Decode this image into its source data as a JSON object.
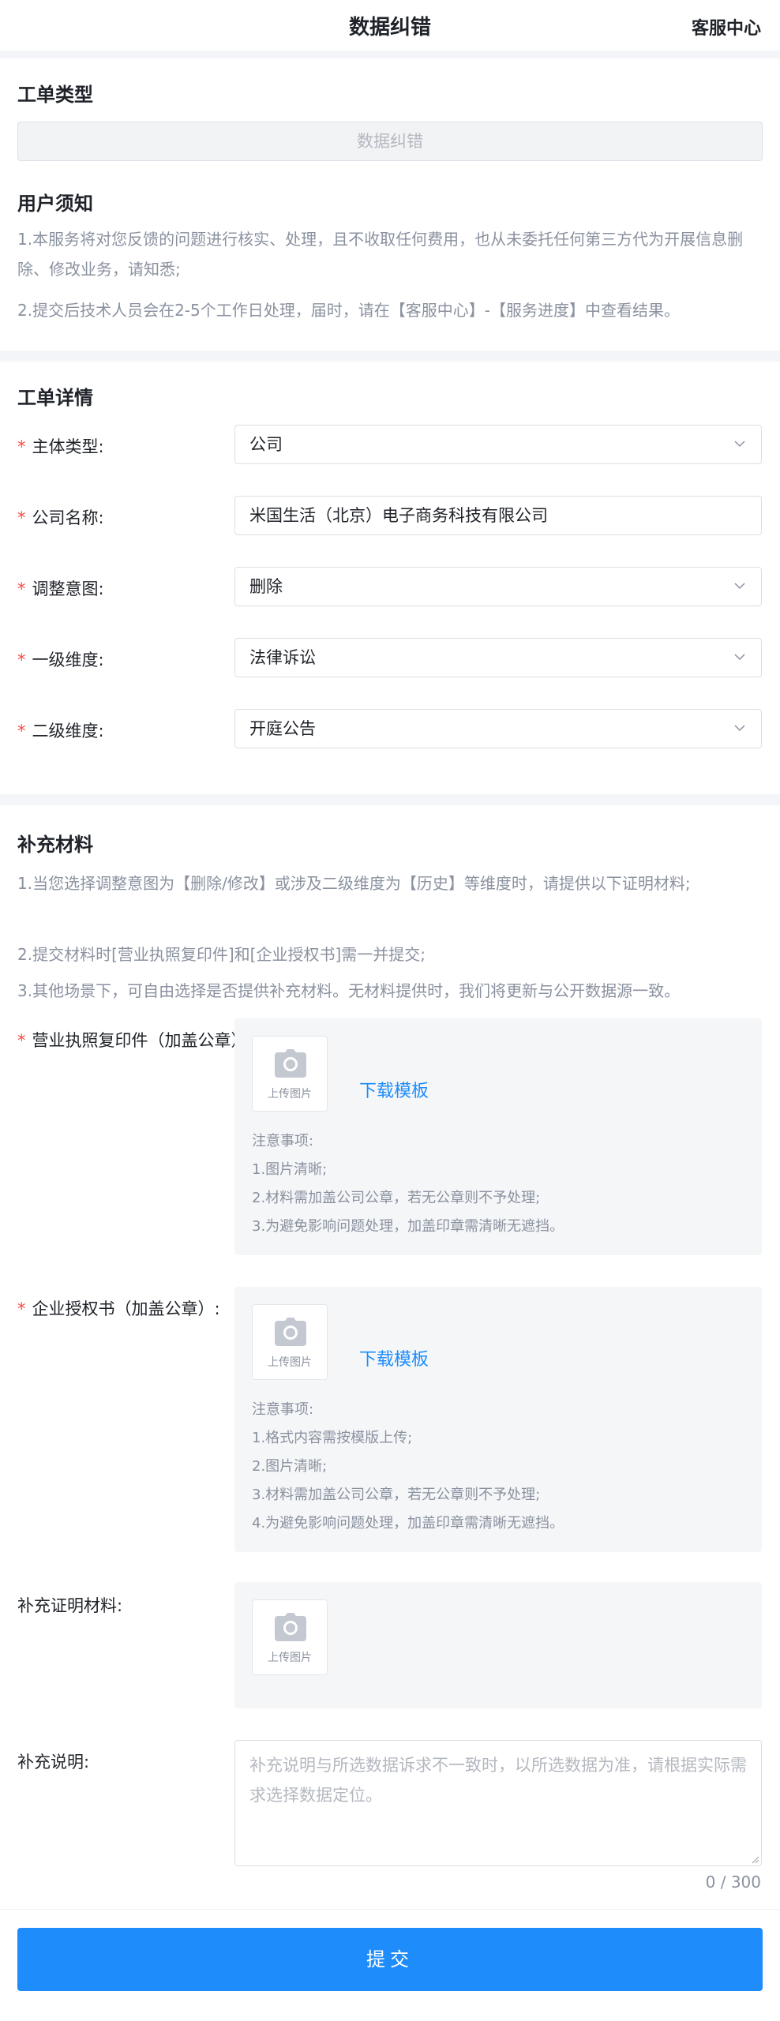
{
  "header": {
    "title": "数据纠错",
    "service_link": "客服中心"
  },
  "ticket_type": {
    "title": "工单类型",
    "value": "数据纠错"
  },
  "notice": {
    "title": "用户须知",
    "p1": "1.本服务将对您反馈的问题进行核实、处理，且不收取任何费用，也从未委托任何第三方代为开展信息删除、修改业务，请知悉;",
    "p2": "2.提交后技术人员会在2-5个工作日处理，届时，请在【客服中心】-【服务进度】中查看结果。"
  },
  "details": {
    "title": "工单详情",
    "fields": [
      {
        "label": "主体类型:",
        "value": "公司",
        "kind": "select"
      },
      {
        "label": "公司名称:",
        "value": "米国生活（北京）电子商务科技有限公司",
        "kind": "input"
      },
      {
        "label": "调整意图:",
        "value": "删除",
        "kind": "select"
      },
      {
        "label": "一级维度:",
        "value": "法律诉讼",
        "kind": "select"
      },
      {
        "label": "二级维度:",
        "value": "开庭公告",
        "kind": "select"
      }
    ]
  },
  "materials": {
    "title": "补充材料",
    "p1": "1.当您选择调整意图为【删除/修改】或涉及二级维度为【历史】等维度时，请提供以下证明材料;",
    "p2": "2.提交材料时[营业执照复印件]和[企业授权书]需一并提交;",
    "p3": "3.其他场景下，可自由选择是否提供补充材料。无材料提供时，我们将更新与公开数据源一致。",
    "upload_label": "上传图片",
    "download_label": "下载模板",
    "license": {
      "label": "营业执照复印件（加盖公章）:",
      "tips": [
        "注意事项:",
        "1.图片清晰;",
        "2.材料需加盖公司公章，若无公章则不予处理;",
        "3.为避免影响问题处理，加盖印章需清晰无遮挡。"
      ]
    },
    "authorization": {
      "label": "企业授权书（加盖公章）:",
      "tips": [
        "注意事项:",
        "1.格式内容需按模版上传;",
        "2.图片清晰;",
        "3.材料需加盖公司公章，若无公章则不予处理;",
        "4.为避免影响问题处理，加盖印章需清晰无遮挡。"
      ]
    },
    "extra": {
      "label": "补充证明材料:"
    },
    "remark": {
      "label": "补充说明:",
      "placeholder": "补充说明与所选数据诉求不一致时，以所选数据为准，请根据实际需求选择数据定位。",
      "counter": "0 / 300"
    }
  },
  "submit_label": "提交"
}
